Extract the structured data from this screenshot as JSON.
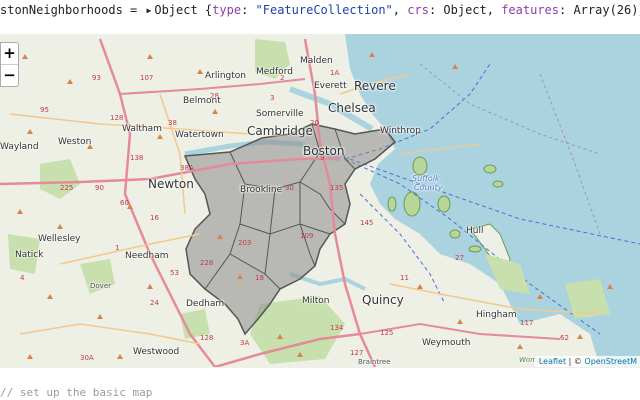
{
  "output": {
    "var_name": "stonNeighborhoods",
    "equals": " = ",
    "object_label": "Object",
    "open": " {",
    "k1": "type",
    "v1": "\"FeatureCollection\"",
    "k2": "crs",
    "v2": "Object",
    "k3": "features",
    "v3": "Array(26)",
    "close": "}"
  },
  "map": {
    "zoom_in": "+",
    "zoom_out": "−",
    "labels": {
      "malden": "Malden",
      "medford": "Medford",
      "arlington": "Arlington",
      "everett": "Everett",
      "revere": "Revere",
      "belmont": "Belmont",
      "chelsea": "Chelsea",
      "somerville": "Somerville",
      "waltham": "Waltham",
      "watertown": "Watertown",
      "cambridge": "Cambridge",
      "winthrop": "Winthrop",
      "weston": "Weston",
      "wayland": "Wayland",
      "boston": "Boston",
      "newton": "Newton",
      "brookline": "Brookline",
      "suffolk": "Suffolk",
      "county": "County",
      "wellesley": "Wellesley",
      "hull": "Hull",
      "needham": "Needham",
      "natick": "Natick",
      "dover": "Dover",
      "dedham": "Dedham",
      "milton": "Milton",
      "quincy": "Quincy",
      "hingham": "Hingham",
      "weymouth": "Weymouth",
      "westwood": "Westwood",
      "braintree": "Braintree",
      "wompatuck": "Wompatuc"
    },
    "road_numbers": [
      "93",
      "95",
      "128",
      "90",
      "60",
      "16",
      "2",
      "1A",
      "3",
      "28",
      "38",
      "20",
      "9",
      "30",
      "135",
      "109",
      "203",
      "228",
      "53",
      "18",
      "138",
      "1",
      "24",
      "128",
      "3A",
      "134",
      "127",
      "125",
      "11",
      "27",
      "117",
      "62",
      "225",
      "4",
      "30A",
      "38A",
      "145",
      "107"
    ],
    "attribution": {
      "leaflet": "Leaflet",
      "sep": " | © ",
      "osm": "OpenStreetM"
    }
  },
  "code": {
    "comment": "// set up the basic map"
  },
  "colors": {
    "water": "#aad3df",
    "land": "#eef0e6",
    "park": "#c8dfae",
    "neighborhood_fill": "#8c8c8c",
    "neighborhood_stroke": "#555555",
    "road_major": "#e58a9a",
    "road_secondary": "#f2c98a"
  }
}
